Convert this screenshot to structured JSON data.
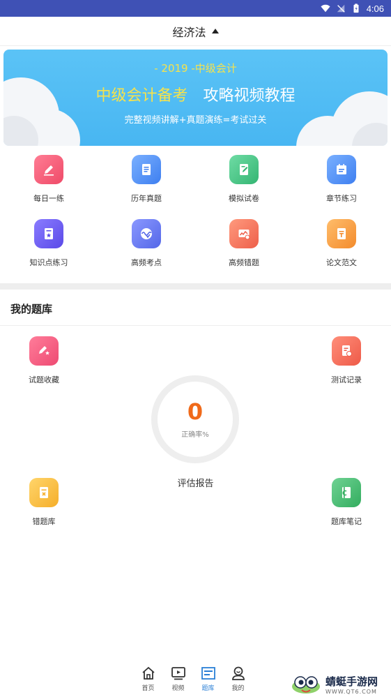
{
  "status_bar": {
    "time": "4:06",
    "icons": [
      "wifi-icon",
      "signal-off-icon",
      "battery-icon"
    ]
  },
  "header": {
    "title": "经济法",
    "caret": "caret-up-icon"
  },
  "banner": {
    "line1": "- 2019 -中级会计",
    "line2_highlight": "中级会计备考",
    "line2_rest": "攻略视频教程",
    "line3": "完整视频讲解+真题演练=考试过关"
  },
  "grid": [
    {
      "label": "每日一练",
      "icon": "pencil-icon",
      "color": "#f0506e"
    },
    {
      "label": "历年真题",
      "icon": "document-icon",
      "color": "#4a8cf0"
    },
    {
      "label": "模拟试卷",
      "icon": "edit-paper-icon",
      "color": "#3fbf7f"
    },
    {
      "label": "章节练习",
      "icon": "calendar-list-icon",
      "color": "#4a8cf0"
    },
    {
      "label": "知识点练习",
      "icon": "star-paper-icon",
      "color": "#6a5cf0"
    },
    {
      "label": "高频考点",
      "icon": "wave-circle-icon",
      "color": "#6a7cf0"
    },
    {
      "label": "高频错题",
      "icon": "chart-error-icon",
      "color": "#f0705a"
    },
    {
      "label": "论文范文",
      "icon": "essay-icon",
      "color": "#f59a3a"
    }
  ],
  "my_bank": {
    "title": "我的题库",
    "items": {
      "favorites": {
        "label": "试题收藏",
        "icon": "star-pencil-icon",
        "color": "#f0567a"
      },
      "test_records": {
        "label": "测试记录",
        "icon": "record-icon",
        "color": "#f06a5a"
      },
      "wrong_bank": {
        "label": "错题库",
        "icon": "wrong-paper-icon",
        "color": "#f5b93a"
      },
      "notes": {
        "label": "题库笔记",
        "icon": "notebook-icon",
        "color": "#3fb86a"
      }
    },
    "accuracy_value": "0",
    "accuracy_label": "正确率%",
    "report_label": "评估报告"
  },
  "bottom_nav": [
    {
      "label": "首页",
      "icon": "home-icon",
      "active": false
    },
    {
      "label": "视频",
      "icon": "video-icon",
      "active": false
    },
    {
      "label": "题库",
      "icon": "question-bank-icon",
      "active": true
    },
    {
      "label": "我的",
      "icon": "profile-icon",
      "active": false
    }
  ],
  "watermark": {
    "title": "蜻蜓手游网",
    "url": "WWW.QT6.COM"
  },
  "colors": {
    "accent": "#2a7fd6",
    "status_bar": "#3f51b5",
    "accuracy": "#f06a1a"
  }
}
